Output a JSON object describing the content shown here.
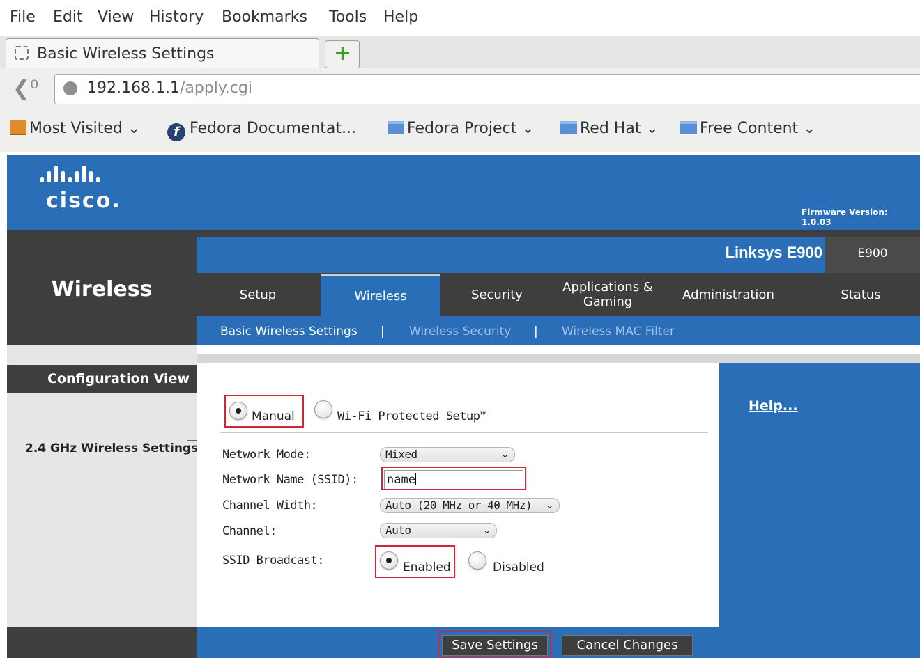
{
  "browser": {
    "menu": [
      "File",
      "Edit",
      "View",
      "History",
      "Bookmarks",
      "Tools",
      "Help"
    ],
    "tab_title": "Basic Wireless Settings",
    "url_host": "192.168.1.1",
    "url_path": "/apply.cgi",
    "bookmarks": [
      "Most Visited",
      "Fedora Documentat...",
      "Fedora Project",
      "Red Hat",
      "Free Content"
    ]
  },
  "router": {
    "brand": "cisco.",
    "firmware": "Firmware Version: 1.0.03",
    "model_name": "Linksys E900",
    "model_code": "E900",
    "section": "Wireless",
    "tabs": [
      "Setup",
      "Wireless",
      "Security",
      "Applications &\nGaming",
      "Administration",
      "Status"
    ],
    "active_tab": "Wireless",
    "subnav": [
      "Basic Wireless Settings",
      "Wireless Security",
      "Wireless MAC Filter"
    ],
    "subnav_sep": "|",
    "config_view": "Configuration View",
    "group_label": "2.4 GHz Wireless Settings",
    "help": "Help...",
    "mode_options": [
      "Manual",
      "Wi-Fi Protected Setup™"
    ],
    "mode_selected": "Manual",
    "fields": {
      "network_mode_label": "Network Mode:",
      "network_mode_value": "Mixed",
      "ssid_label": "Network Name (SSID):",
      "ssid_value": "name",
      "channel_width_label": "Channel Width:",
      "channel_width_value": "Auto (20 MHz or 40 MHz)",
      "channel_label": "Channel:",
      "channel_value": "Auto",
      "ssid_broadcast_label": "SSID Broadcast:",
      "broadcast_options": [
        "Enabled",
        "Disabled"
      ],
      "broadcast_selected": "Enabled"
    },
    "buttons": {
      "save": "Save Settings",
      "cancel": "Cancel Changes"
    }
  }
}
